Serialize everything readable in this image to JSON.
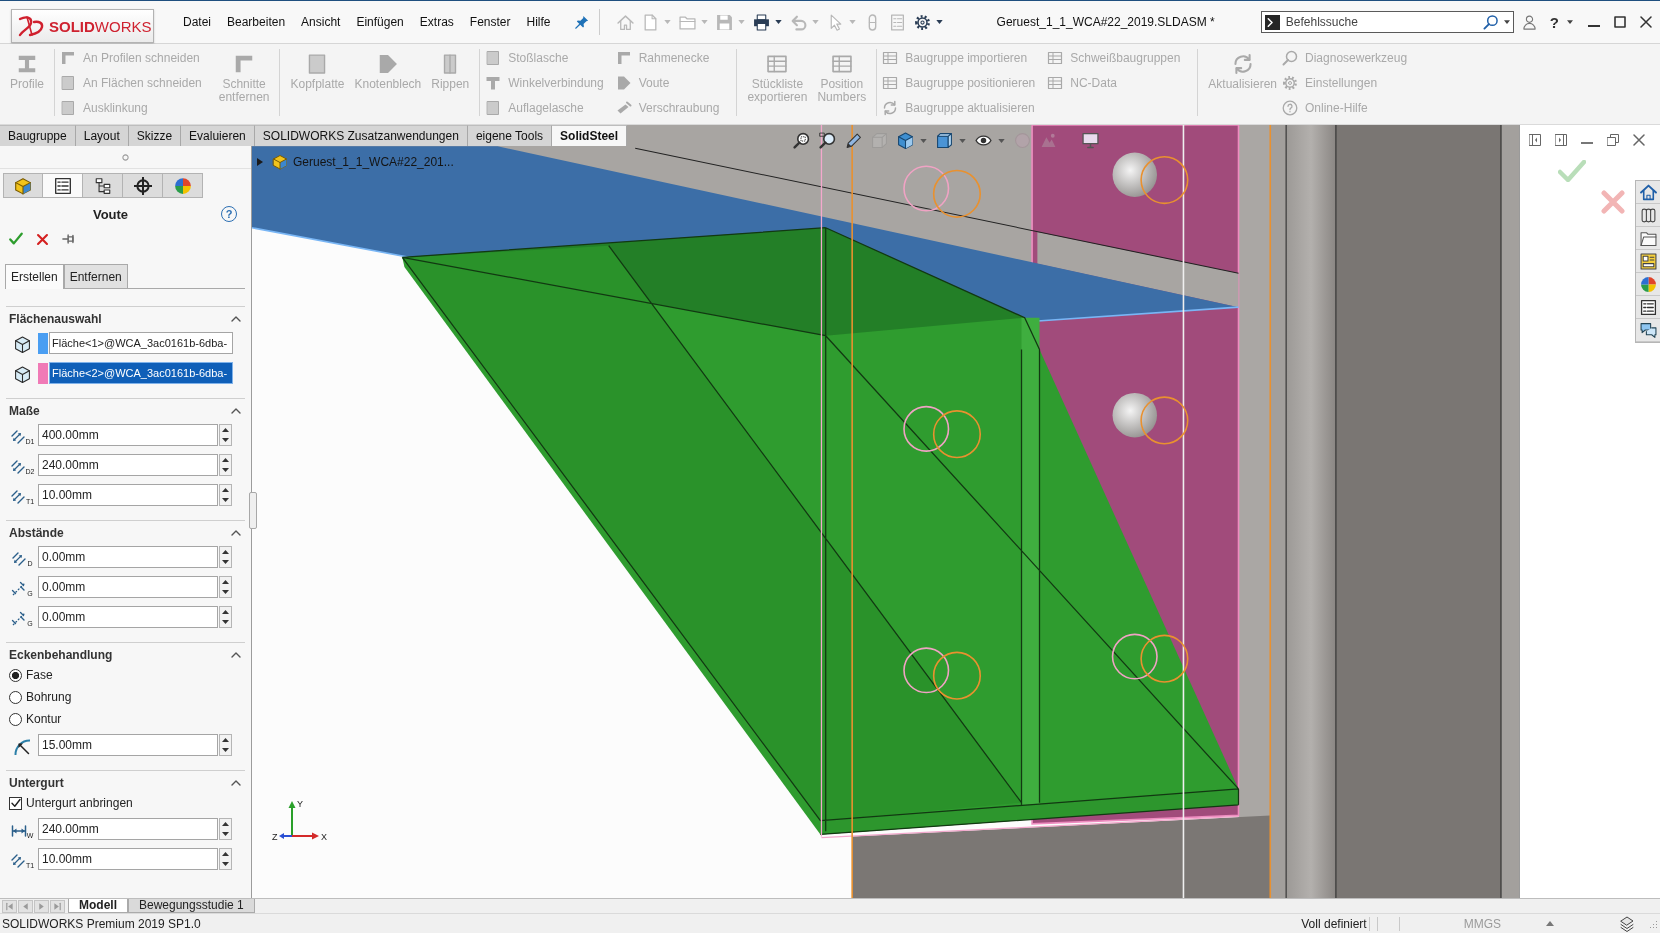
{
  "title_bar": {
    "logo": "**SOLID**WORKS",
    "menu": [
      "Datei",
      "Bearbeiten",
      "Ansicht",
      "Einfügen",
      "Extras",
      "Fenster",
      "Hilfe"
    ],
    "quick_access": [
      {
        "kind": "home",
        "disabled": true,
        "dropdown": false
      },
      {
        "kind": "new",
        "disabled": true,
        "dropdown": true
      },
      {
        "kind": "open",
        "disabled": true,
        "dropdown": true
      },
      {
        "kind": "save",
        "disabled": true,
        "dropdown": true
      },
      {
        "kind": "print",
        "disabled": false,
        "dropdown": true
      },
      {
        "kind": "undo",
        "disabled": true,
        "dropdown": true
      },
      {
        "kind": "select",
        "disabled": true,
        "dropdown": true
      },
      {
        "kind": "rebuild",
        "disabled": true,
        "dropdown": false
      },
      {
        "kind": "file_properties",
        "disabled": true,
        "dropdown": false
      },
      {
        "kind": "options",
        "disabled": false,
        "dropdown": true
      }
    ],
    "document_title": "Geruest_1_1_WCA#22_2019.SLDASM *",
    "search": {
      "placeholder": "Befehlssuche"
    },
    "help": "?"
  },
  "ribbon": {
    "groups": [
      {
        "columns": [
          {
            "kind": "large",
            "label": "Profile",
            "disabled": true
          }
        ]
      },
      {
        "columns": [
          {
            "kind": "stack",
            "items": [
              {
                "label": "An Profilen schneiden",
                "disabled": true
              },
              {
                "label": "An Flächen schneiden",
                "disabled": true
              },
              {
                "label": "Ausklinkung",
                "disabled": true
              }
            ]
          },
          {
            "kind": "large",
            "label": "Schnitte entfernen",
            "disabled": true
          }
        ]
      },
      {
        "columns": [
          {
            "kind": "large",
            "label": "Kopfplatte",
            "disabled": true
          },
          {
            "kind": "large",
            "label": "Knotenblech",
            "disabled": true
          },
          {
            "kind": "large",
            "label": "Rippen",
            "disabled": true
          }
        ]
      },
      {
        "columns": [
          {
            "kind": "stack",
            "items": [
              {
                "label": "Stoßlasche",
                "disabled": true
              },
              {
                "label": "Winkelverbindung",
                "disabled": true
              },
              {
                "label": "Auflagelasche",
                "disabled": true
              }
            ]
          },
          {
            "kind": "stack",
            "items": [
              {
                "label": "Rahmenecke",
                "disabled": true
              },
              {
                "label": "Voute",
                "disabled": true
              },
              {
                "label": "Verschraubung",
                "disabled": true
              }
            ]
          }
        ]
      },
      {
        "columns": [
          {
            "kind": "large",
            "label": "Stückliste exportieren",
            "disabled": true
          },
          {
            "kind": "large",
            "label": "Position Numbers",
            "disabled": true
          }
        ]
      },
      {
        "columns": [
          {
            "kind": "stack",
            "items": [
              {
                "label": "Baugruppe importieren",
                "disabled": true
              },
              {
                "label": "Baugruppe positionieren",
                "disabled": true
              },
              {
                "label": "Baugruppe aktualisieren",
                "disabled": true
              }
            ]
          },
          {
            "kind": "stack",
            "items": [
              {
                "label": "Schweißbaugruppen",
                "disabled": true
              },
              {
                "label": "NC-Data",
                "disabled": true
              }
            ]
          }
        ]
      },
      {
        "columns": [
          {
            "kind": "large",
            "label": "Aktualisieren",
            "disabled": true
          },
          {
            "kind": "stack",
            "items": [
              {
                "label": "Diagnosewerkzeug",
                "disabled": true
              },
              {
                "label": "Einstellungen",
                "disabled": true
              },
              {
                "label": "Online-Hilfe",
                "disabled": true
              }
            ]
          }
        ]
      }
    ]
  },
  "tabs": [
    {
      "label": "Baugruppe",
      "selected": false
    },
    {
      "label": "Layout",
      "selected": false
    },
    {
      "label": "Skizze",
      "selected": false
    },
    {
      "label": "Evaluieren",
      "selected": false
    },
    {
      "label": "SOLIDWORKS Zusatzanwendungen",
      "selected": false
    },
    {
      "label": "eigene Tools",
      "selected": false
    },
    {
      "label": "SolidSteel",
      "selected": true
    }
  ],
  "property_manager": {
    "manager_tabs": [
      {
        "kind": "feature_tree",
        "selected": false
      },
      {
        "kind": "properties",
        "selected": true
      },
      {
        "kind": "configurations",
        "selected": false
      },
      {
        "kind": "dimxpert",
        "selected": false
      },
      {
        "kind": "display",
        "selected": false
      }
    ],
    "title": "Voute",
    "help": "?",
    "tabs": [
      {
        "label": "Erstellen",
        "selected": true
      },
      {
        "label": "Entfernen",
        "selected": false
      }
    ],
    "sections": [
      {
        "title": "Flächenauswahl",
        "expanded": true,
        "rows": [
          {
            "kind": "face",
            "color": "#4a9ef2",
            "value": "Fläche<1>@WCA_3ac0161b-6dba-",
            "selected": false
          },
          {
            "kind": "face",
            "color": "#f07ab6",
            "value": "Fläche<2>@WCA_3ac0161b-6dba-",
            "selected": true
          }
        ]
      },
      {
        "title": "Maße",
        "expanded": true,
        "rows": [
          {
            "kind": "dimension",
            "symbol": "D1",
            "value": "400.00mm"
          },
          {
            "kind": "dimension",
            "symbol": "D2",
            "value": "240.00mm"
          },
          {
            "kind": "dimension",
            "symbol": "T1",
            "value": "10.00mm"
          }
        ]
      },
      {
        "title": "Abstände",
        "expanded": true,
        "rows": [
          {
            "kind": "dimension",
            "symbol": "D",
            "value": "0.00mm"
          },
          {
            "kind": "gap",
            "symbol": "G",
            "value": "0.00mm"
          },
          {
            "kind": "gap",
            "symbol": "G",
            "value": "0.00mm"
          }
        ]
      },
      {
        "title": "Eckenbehandlung",
        "expanded": true,
        "rows": [
          {
            "kind": "radio",
            "label": "Fase",
            "selected": true
          },
          {
            "kind": "radio",
            "label": "Bohrung",
            "selected": false
          },
          {
            "kind": "radio",
            "label": "Kontur",
            "selected": false
          },
          {
            "kind": "radius",
            "value": "15.00mm"
          }
        ]
      },
      {
        "title": "Untergurt",
        "expanded": true,
        "rows": [
          {
            "kind": "checkbox",
            "label": "Untergurt anbringen",
            "checked": true
          },
          {
            "kind": "width",
            "symbol": "W",
            "value": "240.00mm"
          },
          {
            "kind": "dimension",
            "symbol": "T1",
            "value": "10.00mm"
          }
        ]
      }
    ]
  },
  "viewport": {
    "view_toolbar": [
      {
        "kind": "zoom_fit",
        "disabled": false,
        "dropdown": false
      },
      {
        "kind": "zoom_area",
        "disabled": false,
        "dropdown": false
      },
      {
        "kind": "previous_view",
        "disabled": false,
        "dropdown": false
      },
      {
        "kind": "section_view",
        "disabled": true,
        "dropdown": false
      },
      {
        "kind": "view_orientation",
        "disabled": false,
        "dropdown": true
      },
      {
        "kind": "display_style",
        "disabled": false,
        "dropdown": true
      },
      {
        "kind": "hide_show",
        "disabled": false,
        "dropdown": true
      },
      {
        "kind": "edit_appearance",
        "disabled": true,
        "dropdown": false
      },
      {
        "kind": "apply_scene",
        "disabled": true,
        "dropdown": false
      },
      {
        "kind": "view_settings",
        "disabled": false,
        "dropdown": false
      }
    ],
    "tree_item": "Geruest_1_1_WCA#22_201...",
    "triad": {
      "y": "Y",
      "z": "Z",
      "x": "X"
    }
  },
  "bottom_tabs": [
    {
      "label": "Modell",
      "selected": true
    },
    {
      "label": "Bewegungsstudie 1",
      "selected": false
    }
  ],
  "status_bar": {
    "product": "SOLIDWORKS Premium 2019 SP1.0",
    "state": "Voll definiert",
    "units": "MMGS"
  }
}
